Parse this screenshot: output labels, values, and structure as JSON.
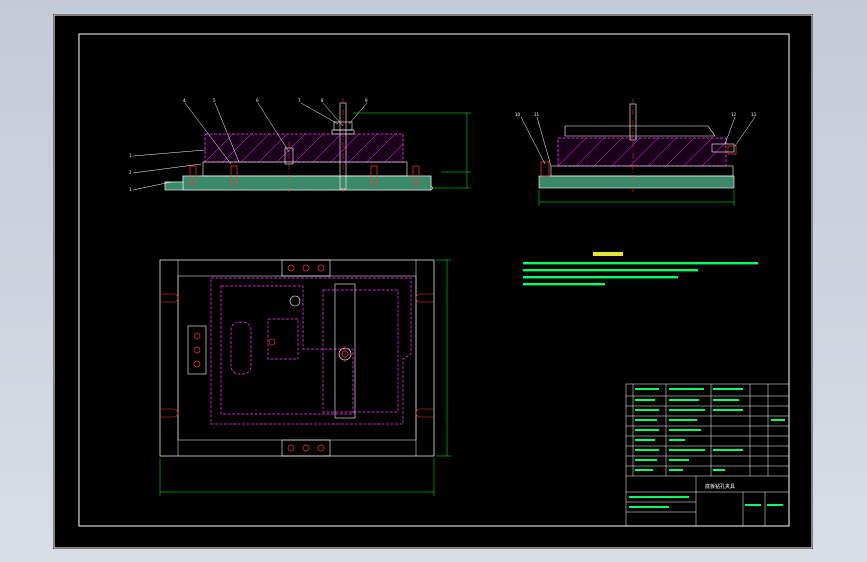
{
  "title_block": {
    "drawing_name": "底板钻孔夹具"
  },
  "colors": {
    "background": "#000000",
    "frame": "#ffffff",
    "part_line": "#ff33ff",
    "dimension": "#00ff00",
    "centerline": "#ff3333",
    "leader": "#ffffff",
    "body_fill": "#3a8a6a",
    "note_text": "#00ff66",
    "heading_text": "#ffff33"
  },
  "icons": [
    "bolt-icon",
    "hole-icon",
    "slot-icon"
  ]
}
